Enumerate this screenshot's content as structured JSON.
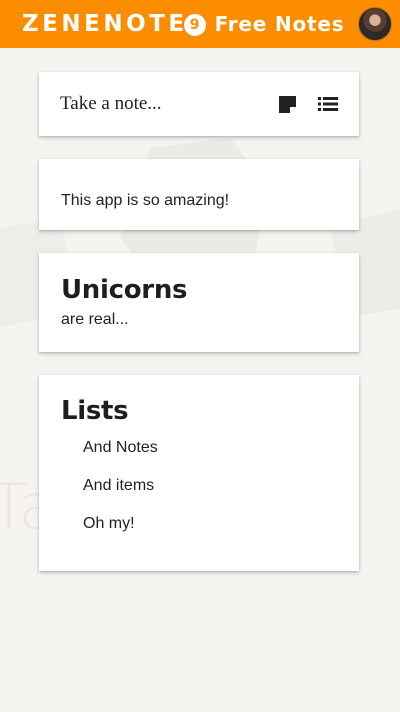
{
  "header": {
    "brand": "ZENENOTE",
    "brand_badge": "9",
    "subtitle": "Free Notes",
    "colors": {
      "header_bg": "#fc8c00",
      "text": "#ffffff"
    }
  },
  "composer": {
    "placeholder": "Take a note...",
    "icons": [
      "sticky-note-icon",
      "list-icon"
    ]
  },
  "notes": [
    {
      "title": "",
      "body": "This app is so amazing!"
    },
    {
      "title": "Unicorns",
      "body": "are real..."
    },
    {
      "title": "Lists",
      "items": [
        "And Notes",
        "And items",
        "Oh my!"
      ]
    }
  ],
  "background": {
    "watermark": "Ta                    es"
  }
}
